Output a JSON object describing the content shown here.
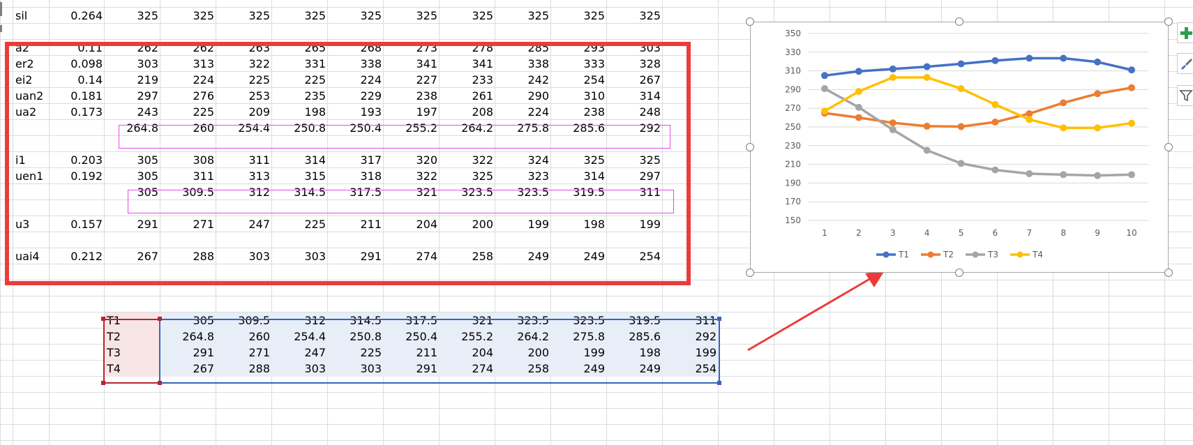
{
  "sheet": {
    "rows": [
      {
        "label": "sil",
        "coef": "0.264",
        "values": [
          "325",
          "325",
          "325",
          "325",
          "325",
          "325",
          "325",
          "325",
          "325",
          "325"
        ]
      },
      {
        "label": "a2",
        "coef": "0.11",
        "values": [
          "262",
          "262",
          "263",
          "265",
          "268",
          "273",
          "278",
          "285",
          "293",
          "303"
        ]
      },
      {
        "label": "er2",
        "coef": "0.098",
        "values": [
          "303",
          "313",
          "322",
          "331",
          "338",
          "341",
          "341",
          "338",
          "333",
          "328"
        ]
      },
      {
        "label": "ei2",
        "coef": "0.14",
        "values": [
          "219",
          "224",
          "225",
          "225",
          "224",
          "227",
          "233",
          "242",
          "254",
          "267"
        ]
      },
      {
        "label": "uan2",
        "coef": "0.181",
        "values": [
          "297",
          "276",
          "253",
          "235",
          "229",
          "238",
          "261",
          "290",
          "310",
          "314"
        ]
      },
      {
        "label": "ua2",
        "coef": "0.173",
        "values": [
          "243",
          "225",
          "209",
          "198",
          "193",
          "197",
          "208",
          "224",
          "238",
          "248"
        ]
      },
      {
        "label": "",
        "coef": "",
        "values": [
          "264.8",
          "260",
          "254.4",
          "250.8",
          "250.4",
          "255.2",
          "264.2",
          "275.8",
          "285.6",
          "292"
        ]
      },
      {
        "label": "i1",
        "coef": "0.203",
        "values": [
          "305",
          "308",
          "311",
          "314",
          "317",
          "320",
          "322",
          "324",
          "325",
          "325"
        ]
      },
      {
        "label": "uen1",
        "coef": "0.192",
        "values": [
          "305",
          "311",
          "313",
          "315",
          "318",
          "322",
          "325",
          "323",
          "314",
          "297"
        ]
      },
      {
        "label": "",
        "coef": "",
        "values": [
          "305",
          "309.5",
          "312",
          "314.5",
          "317.5",
          "321",
          "323.5",
          "323.5",
          "319.5",
          "311"
        ]
      },
      {
        "label": "u3",
        "coef": "0.157",
        "values": [
          "291",
          "271",
          "247",
          "225",
          "211",
          "204",
          "200",
          "199",
          "198",
          "199"
        ]
      },
      {
        "label": "uai4",
        "coef": "0.212",
        "values": [
          "267",
          "288",
          "303",
          "303",
          "291",
          "274",
          "258",
          "249",
          "249",
          "254"
        ]
      }
    ],
    "summary": [
      {
        "label": "T1",
        "values": [
          "305",
          "309.5",
          "312",
          "314.5",
          "317.5",
          "321",
          "323.5",
          "323.5",
          "319.5",
          "311"
        ]
      },
      {
        "label": "T2",
        "values": [
          "264.8",
          "260",
          "254.4",
          "250.8",
          "250.4",
          "255.2",
          "264.2",
          "275.8",
          "285.6",
          "292"
        ]
      },
      {
        "label": "T3",
        "values": [
          "291",
          "271",
          "247",
          "225",
          "211",
          "204",
          "200",
          "199",
          "198",
          "199"
        ]
      },
      {
        "label": "T4",
        "values": [
          "267",
          "288",
          "303",
          "303",
          "291",
          "274",
          "258",
          "249",
          "249",
          "254"
        ]
      }
    ]
  },
  "chart_data": {
    "type": "line",
    "title": "",
    "xlabel": "",
    "ylabel": "",
    "categories": [
      "1",
      "2",
      "3",
      "4",
      "5",
      "6",
      "7",
      "8",
      "9",
      "10"
    ],
    "ylim": [
      150,
      350
    ],
    "yticks": [
      "150",
      "170",
      "190",
      "210",
      "230",
      "250",
      "270",
      "290",
      "310",
      "330",
      "350"
    ],
    "grid": true,
    "legend": "bottom",
    "series": [
      {
        "name": "T1",
        "color": "#4472c4",
        "values": [
          305,
          309.5,
          312,
          314.5,
          317.5,
          321,
          323.5,
          323.5,
          319.5,
          311
        ]
      },
      {
        "name": "T2",
        "color": "#ed7d31",
        "values": [
          264.8,
          260,
          254.4,
          250.8,
          250.4,
          255.2,
          264.2,
          275.8,
          285.6,
          292
        ]
      },
      {
        "name": "T3",
        "color": "#a5a5a5",
        "values": [
          291,
          271,
          247,
          225,
          211,
          204,
          200,
          199,
          198,
          199
        ]
      },
      {
        "name": "T4",
        "color": "#ffc000",
        "values": [
          267,
          288,
          303,
          303,
          291,
          274,
          258,
          249,
          249,
          254
        ]
      }
    ]
  },
  "chart_buttons": [
    {
      "icon": "plus-icon"
    },
    {
      "icon": "brush-icon"
    },
    {
      "icon": "filter-icon"
    }
  ],
  "colors": {
    "highlight_box": "#ee3a3a",
    "row_box": "#e34ee3",
    "selection_labels": "#b62433",
    "selection_values": "#3466b9",
    "arrow": "#ee3a3a"
  }
}
